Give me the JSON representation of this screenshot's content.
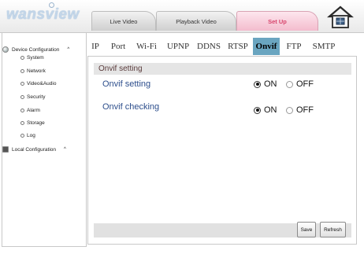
{
  "header": {
    "logo_text": "wansview",
    "tabs": [
      {
        "label": "Live Video"
      },
      {
        "label": "Playback Video"
      },
      {
        "label": "Set Up"
      }
    ]
  },
  "sidebar": {
    "device_config_label": "Device Configuration",
    "device_items": [
      {
        "label": "System"
      },
      {
        "label": "Network"
      },
      {
        "label": "Video&Audio"
      },
      {
        "label": "Security"
      },
      {
        "label": "Alarm"
      },
      {
        "label": "Storage"
      },
      {
        "label": "Log"
      }
    ],
    "local_config_label": "Local Configuration",
    "caret": "^"
  },
  "settings_tabs": [
    {
      "label": "IP"
    },
    {
      "label": "Port"
    },
    {
      "label": "Wi-Fi"
    },
    {
      "label": "UPNP"
    },
    {
      "label": "DDNS"
    },
    {
      "label": "RTSP"
    },
    {
      "label": "Onvif"
    },
    {
      "label": "FTP"
    },
    {
      "label": "SMTP"
    }
  ],
  "active_settings_tab": "Onvif",
  "content": {
    "section_title": "Onvif setting",
    "rows": [
      {
        "label": "Onvif setting",
        "on_label": "ON",
        "off_label": "OFF",
        "selected": "ON"
      },
      {
        "label": "Onvif checking",
        "on_label": "ON",
        "off_label": "OFF",
        "selected": "ON"
      }
    ],
    "save_label": "Save",
    "refresh_label": "Refresh"
  },
  "colors": {
    "active_tab": "#6aa5c0",
    "setup_tab_text": "#d8456c",
    "row_label": "#2d4e8c"
  }
}
